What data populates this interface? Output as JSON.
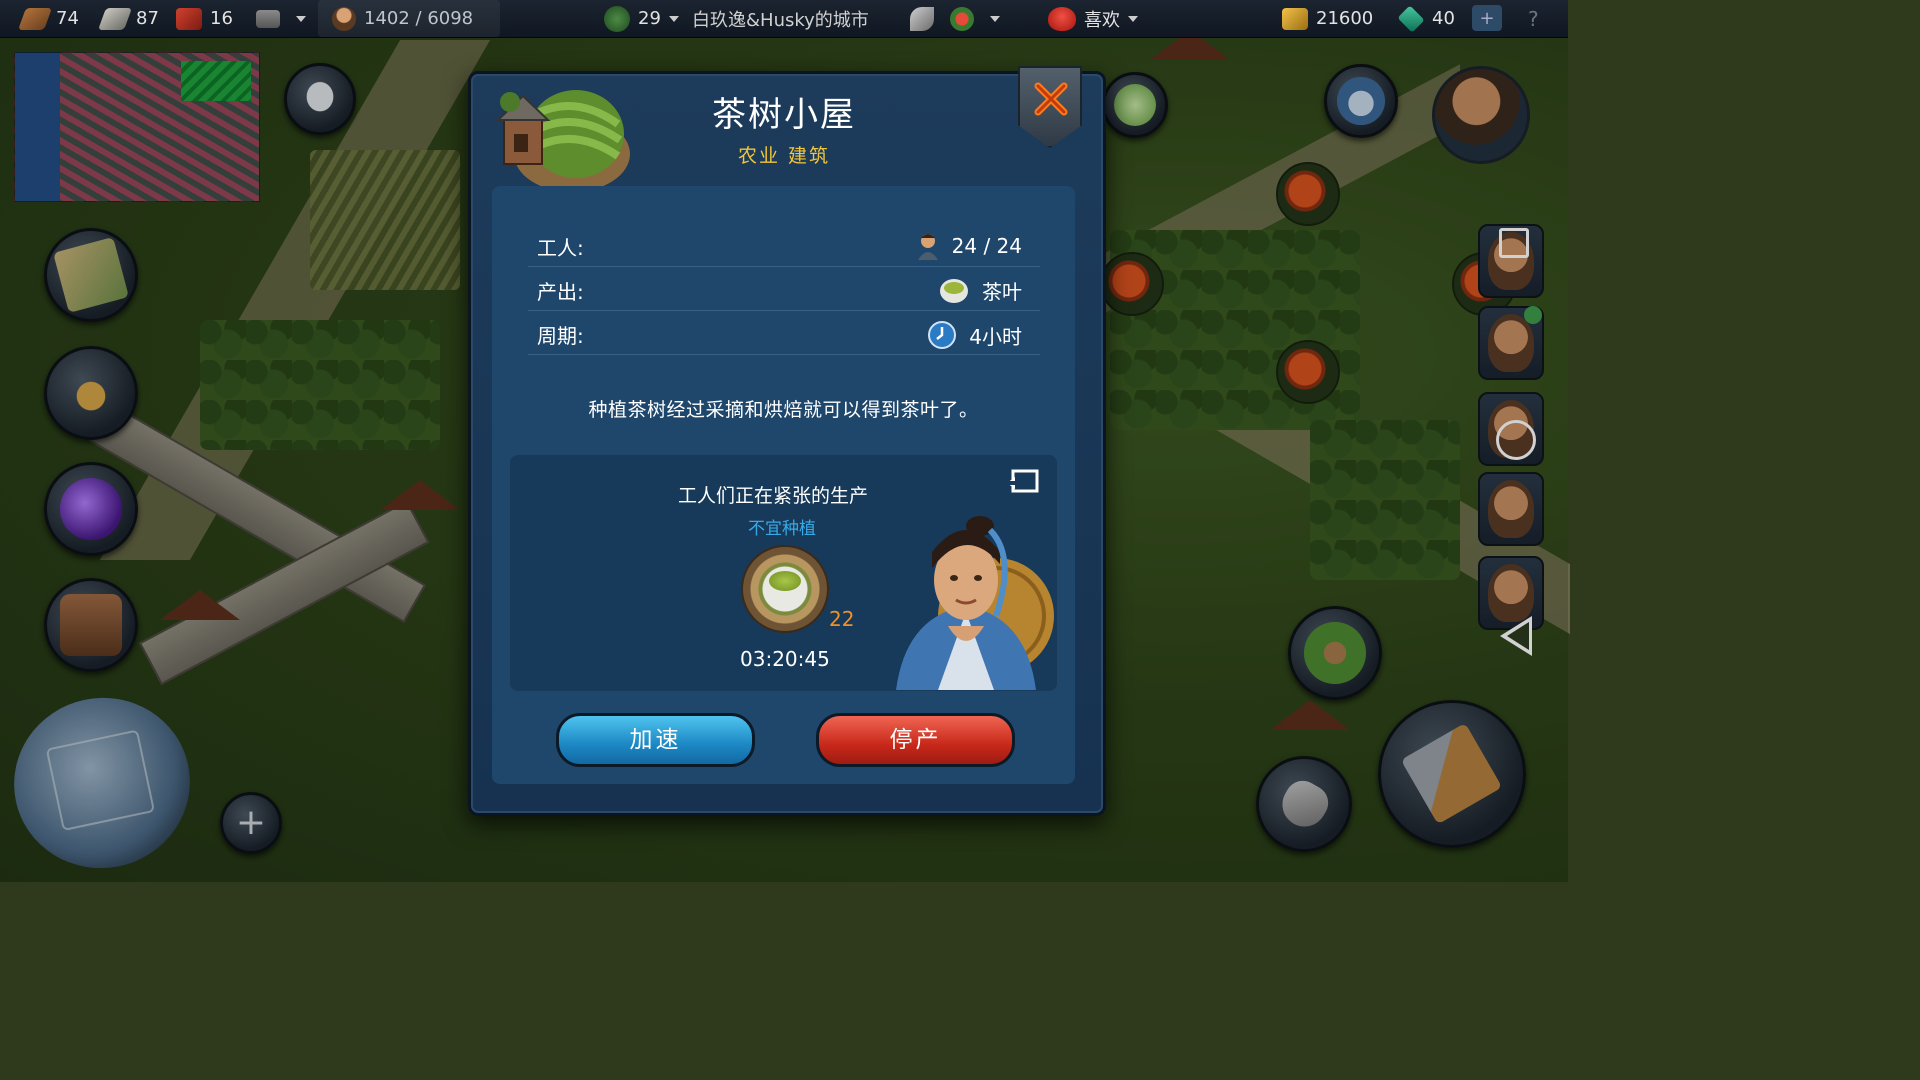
{
  "topbar": {
    "wood": "74",
    "stone": "87",
    "bricks": "16",
    "population": "1402 / 6098",
    "leaf_count": "29",
    "city_name": "白玖逸&Husky的城市",
    "like_label": "喜欢",
    "gold": "21600",
    "gems": "40",
    "add_symbol": "+",
    "help_symbol": "?"
  },
  "dialog": {
    "title": "茶树小屋",
    "subtitle": "农业 建筑",
    "rows": [
      {
        "label": "工人:",
        "value": "24 / 24",
        "icon": "worker-icon"
      },
      {
        "label": "产出:",
        "value": "茶叶",
        "icon": "tea-cup-icon"
      },
      {
        "label": "周期:",
        "value": "4小时",
        "icon": "clock-icon"
      }
    ],
    "description": "种植茶树经过采摘和烘焙就可以得到茶叶了。",
    "production": {
      "status": "工人们正在紧张的生产",
      "warning": "不宜种植",
      "count": "22",
      "timer": "03:20:45"
    },
    "buttons": {
      "speed_up": "加速",
      "stop": "停产"
    }
  },
  "colors": {
    "dialog_bg": "#1d3b5b",
    "subtitle": "#f2c53a",
    "warning": "#37a9e6",
    "count": "#f0902a",
    "speed_button": "#1c87c4",
    "stop_button": "#c8281a"
  }
}
